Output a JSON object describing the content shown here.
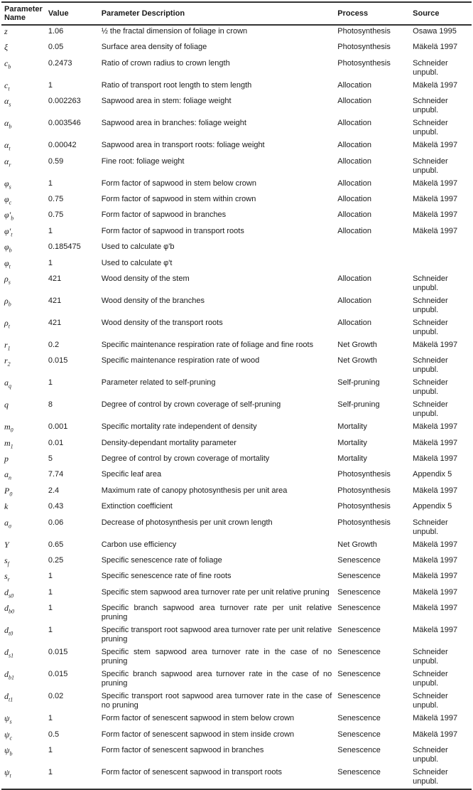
{
  "table": {
    "headers": {
      "name": "Parameter Name",
      "value": "Value",
      "description": "Parameter Description",
      "process": "Process",
      "source": "Source"
    },
    "rows": [
      {
        "sym": "z",
        "sub": "",
        "value": "1.06",
        "description": "½ the fractal dimension of foliage in crown",
        "process": "Photosynthesis",
        "source": "Osawa 1995"
      },
      {
        "sym": "ξ",
        "sub": "",
        "value": "0.05",
        "description": "Surface area density of foliage",
        "process": "Photosynthesis",
        "source": "Mäkelä 1997"
      },
      {
        "sym": "c",
        "sub": "b",
        "value": "0.2473",
        "description": "Ratio of crown radius to crown length",
        "process": "Photosynthesis",
        "source": "Schneider unpubl."
      },
      {
        "sym": "c",
        "sub": "t",
        "value": "1",
        "description": "Ratio of transport root length to stem length",
        "process": "Allocation",
        "source": "Mäkelä 1997"
      },
      {
        "sym": "α",
        "sub": "s",
        "value": "0.002263",
        "description": "Sapwood area in stem: foliage weight",
        "process": "Allocation",
        "source": "Schneider unpubl."
      },
      {
        "sym": "α",
        "sub": "b",
        "value": "0.003546",
        "description": "Sapwood area in branches: foliage weight",
        "process": "Allocation",
        "source": "Schneider unpubl."
      },
      {
        "sym": "α",
        "sub": "t",
        "value": "0.00042",
        "description": "Sapwood area in transport roots: foliage weight",
        "process": "Allocation",
        "source": "Mäkelä 1997"
      },
      {
        "sym": "α",
        "sub": "r",
        "value": "0.59",
        "description": "Fine root: foliage weight",
        "process": "Allocation",
        "source": "Schneider unpubl."
      },
      {
        "sym": "φ",
        "sub": "s",
        "value": "1",
        "description": "Form factor of sapwood in stem below crown",
        "process": "Allocation",
        "source": "Mäkelä 1997"
      },
      {
        "sym": "φ",
        "sub": "c",
        "value": "0.75",
        "description": "Form factor of sapwood in stem within crown",
        "process": "Allocation",
        "source": "Mäkelä 1997"
      },
      {
        "sym": "φ'",
        "sub": "b",
        "value": "0.75",
        "description": "Form factor of sapwood in branches",
        "process": "Allocation",
        "source": "Mäkelä 1997"
      },
      {
        "sym": "φ'",
        "sub": "t",
        "value": "1",
        "description": "Form factor of sapwood in transport roots",
        "process": "Allocation",
        "source": "Mäkelä 1997"
      },
      {
        "sym": "φ",
        "sub": "b",
        "value": "0.185475",
        "description": "Used to calculate φ'b",
        "process": "",
        "source": ""
      },
      {
        "sym": "φ",
        "sub": "t",
        "value": "1",
        "description": "Used to calculate φ't",
        "process": "",
        "source": ""
      },
      {
        "sym": "ρ",
        "sub": "s",
        "value": "421",
        "description": "Wood density of the stem",
        "process": "Allocation",
        "source": "Schneider unpubl."
      },
      {
        "sym": "ρ",
        "sub": "b",
        "value": "421",
        "description": "Wood density of the branches",
        "process": "Allocation",
        "source": "Schneider unpubl."
      },
      {
        "sym": "ρ",
        "sub": "t",
        "value": "421",
        "description": "Wood density of the transport roots",
        "process": "Allocation",
        "source": "Schneider unpubl."
      },
      {
        "sym": "r",
        "sub": "1",
        "value": "0.2",
        "description": "Specific maintenance respiration rate of foliage and fine roots",
        "process": "Net Growth",
        "source": "Mäkelä 1997"
      },
      {
        "sym": "r",
        "sub": "2",
        "value": "0.015",
        "description": "Specific maintenance respiration rate of wood",
        "process": "Net Growth",
        "source": "Schneider unpubl."
      },
      {
        "sym": "a",
        "sub": "q",
        "value": "1",
        "description": "Parameter related to self-pruning",
        "process": "Self-pruning",
        "source": "Schneider unpubl."
      },
      {
        "sym": "q",
        "sub": "",
        "value": "8",
        "description": "Degree of control by crown coverage of self-pruning",
        "process": "Self-pruning",
        "source": "Schneider unpubl."
      },
      {
        "sym": "m",
        "sub": "0",
        "value": "0.001",
        "description": "Specific mortality rate independent of density",
        "process": "Mortality",
        "source": "Mäkelä 1997"
      },
      {
        "sym": "m",
        "sub": "1",
        "value": "0.01",
        "description": "Density-dependant mortality parameter",
        "process": "Mortality",
        "source": "Mäkelä 1997"
      },
      {
        "sym": "p",
        "sub": "",
        "value": "5",
        "description": "Degree of control by crown coverage of mortality",
        "process": "Mortality",
        "source": "Mäkelä 1997"
      },
      {
        "sym": "a",
        "sub": "n",
        "value": "7.74",
        "description": "Specific leaf area",
        "process": "Photosynthesis",
        "source": "Appendix 5"
      },
      {
        "sym": "P",
        "sub": "0",
        "value": "2.4",
        "description": "Maximum rate of canopy photosynthesis per unit area",
        "process": "Photosynthesis",
        "source": "Mäkelä 1997"
      },
      {
        "sym": "k",
        "sub": "",
        "value": "0.43",
        "description": "Extinction coefficient",
        "process": "Photosynthesis",
        "source": "Appendix 5"
      },
      {
        "sym": "a",
        "sub": "σ",
        "value": "0.06",
        "description": "Decrease of photosynthesis per unit crown length",
        "process": "Photosynthesis",
        "source": "Schneider unpubl."
      },
      {
        "sym": "Y",
        "sub": "",
        "value": "0.65",
        "description": "Carbon use efficiency",
        "process": "Net Growth",
        "source": "Mäkelä 1997"
      },
      {
        "sym": "s",
        "sub": "f",
        "value": "0.25",
        "description": "Specific senescence rate of foliage",
        "process": "Senescence",
        "source": "Mäkelä 1997"
      },
      {
        "sym": "s",
        "sub": "r",
        "value": "1",
        "description": "Specific senescence rate of fine roots",
        "process": "Senescence",
        "source": "Mäkelä 1997"
      },
      {
        "sym": "d",
        "sub": "s0",
        "value": "1",
        "description": "Specific stem sapwood area turnover rate per unit relative pruning",
        "process": "Senescence",
        "source": "Mäkelä 1997"
      },
      {
        "sym": "d",
        "sub": "b0",
        "value": "1",
        "description": "Specific branch sapwood area turnover rate per unit relative pruning",
        "process": "Senescence",
        "source": "Mäkelä 1997"
      },
      {
        "sym": "d",
        "sub": "t0",
        "value": "1",
        "description": "Specific transport root sapwood area turnover rate per unit relative pruning",
        "process": "Senescence",
        "source": "Mäkelä 1997"
      },
      {
        "sym": "d",
        "sub": "s1",
        "value": "0.015",
        "description": "Specific stem sapwood area turnover rate in the case of no pruning",
        "process": "Senescence",
        "source": "Schneider unpubl."
      },
      {
        "sym": "d",
        "sub": "b1",
        "value": "0.015",
        "description": "Specific branch sapwood area turnover rate in the case of no pruning",
        "process": "Senescence",
        "source": "Schneider unpubl."
      },
      {
        "sym": "d",
        "sub": "t1",
        "value": "0.02",
        "description": "Specific transport root sapwood area turnover rate in the case of no pruning",
        "process": "Senescence",
        "source": "Schneider unpubl."
      },
      {
        "sym": "ψ",
        "sub": "s",
        "value": "1",
        "description": "Form factor of senescent sapwood in stem below crown",
        "process": "Senescence",
        "source": "Mäkelä 1997"
      },
      {
        "sym": "ψ",
        "sub": "c",
        "value": "0.5",
        "description": "Form factor of senescent sapwood in stem inside crown",
        "process": "Senescence",
        "source": "Mäkelä 1997"
      },
      {
        "sym": "ψ",
        "sub": "b",
        "value": "1",
        "description": "Form factor of senescent sapwood in branches",
        "process": "Senescence",
        "source": "Schneider unpubl."
      },
      {
        "sym": "ψ",
        "sub": "t",
        "value": "1",
        "description": "Form factor of senescent sapwood in transport roots",
        "process": "Senescence",
        "source": "Schneider unpubl."
      }
    ]
  }
}
